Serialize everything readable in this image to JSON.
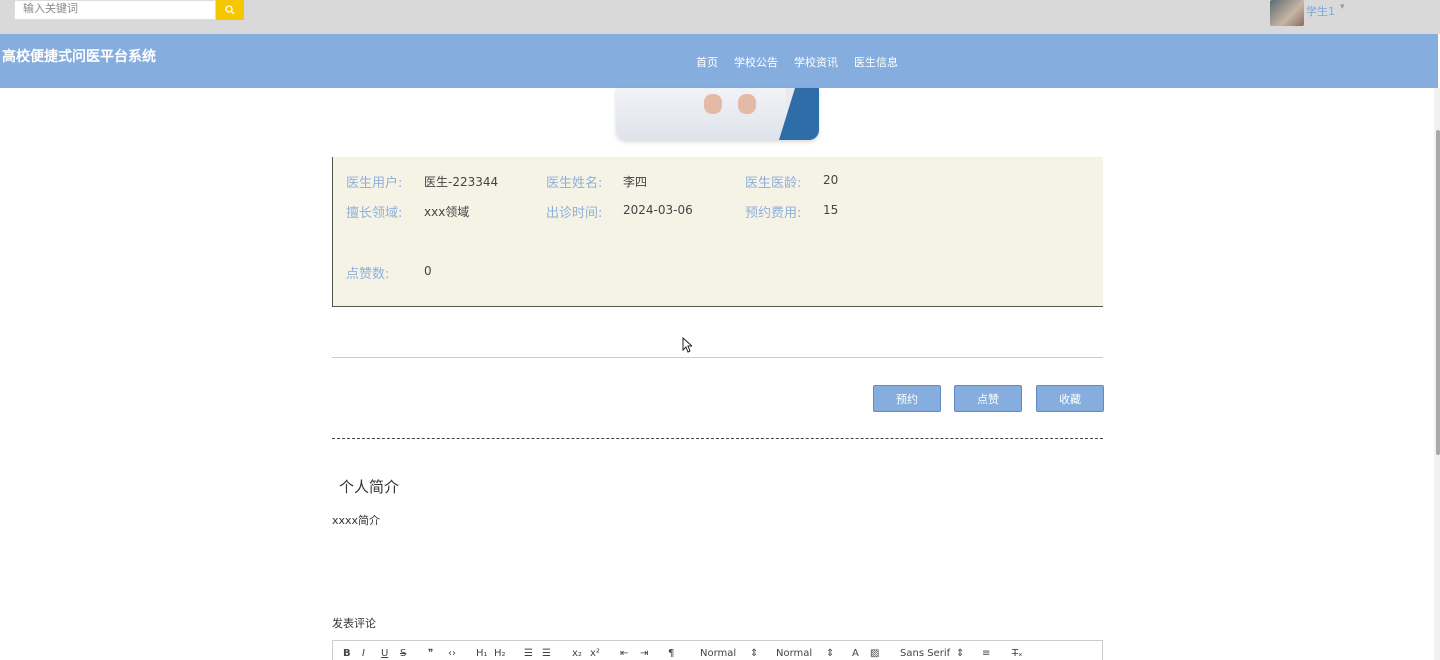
{
  "search": {
    "placeholder": "输入关键词"
  },
  "user": {
    "name": "学生1",
    "caret": "▾"
  },
  "site": {
    "title": "高校便捷式问医平台系统"
  },
  "nav": {
    "items": [
      "首页",
      "学校公告",
      "学校资讯",
      "医生信息"
    ]
  },
  "doctor": {
    "user_label": "医生用户:",
    "user_value": "医生-223344",
    "name_label": "医生姓名:",
    "name_value": "李四",
    "age_label": "医生医龄:",
    "age_value": "20",
    "field_label": "擅长领域:",
    "field_value": "xxx领域",
    "time_label": "出诊时间:",
    "time_value": "2024-03-06",
    "fee_label": "预约费用:",
    "fee_value": "15",
    "likes_label": "点赞数:",
    "likes_value": "0"
  },
  "actions": {
    "book": "预约",
    "like": "点赞",
    "favorite": "收藏"
  },
  "intro": {
    "title": "个人简介",
    "text": "xxxx简介"
  },
  "comment": {
    "label": "发表评论"
  },
  "editor": {
    "header1": "Normal",
    "header2": "Normal",
    "font": "Sans Serif"
  },
  "colors": {
    "accent": "#85aede",
    "info_bg": "#f5f2e6",
    "search_btn": "#f6c700"
  }
}
